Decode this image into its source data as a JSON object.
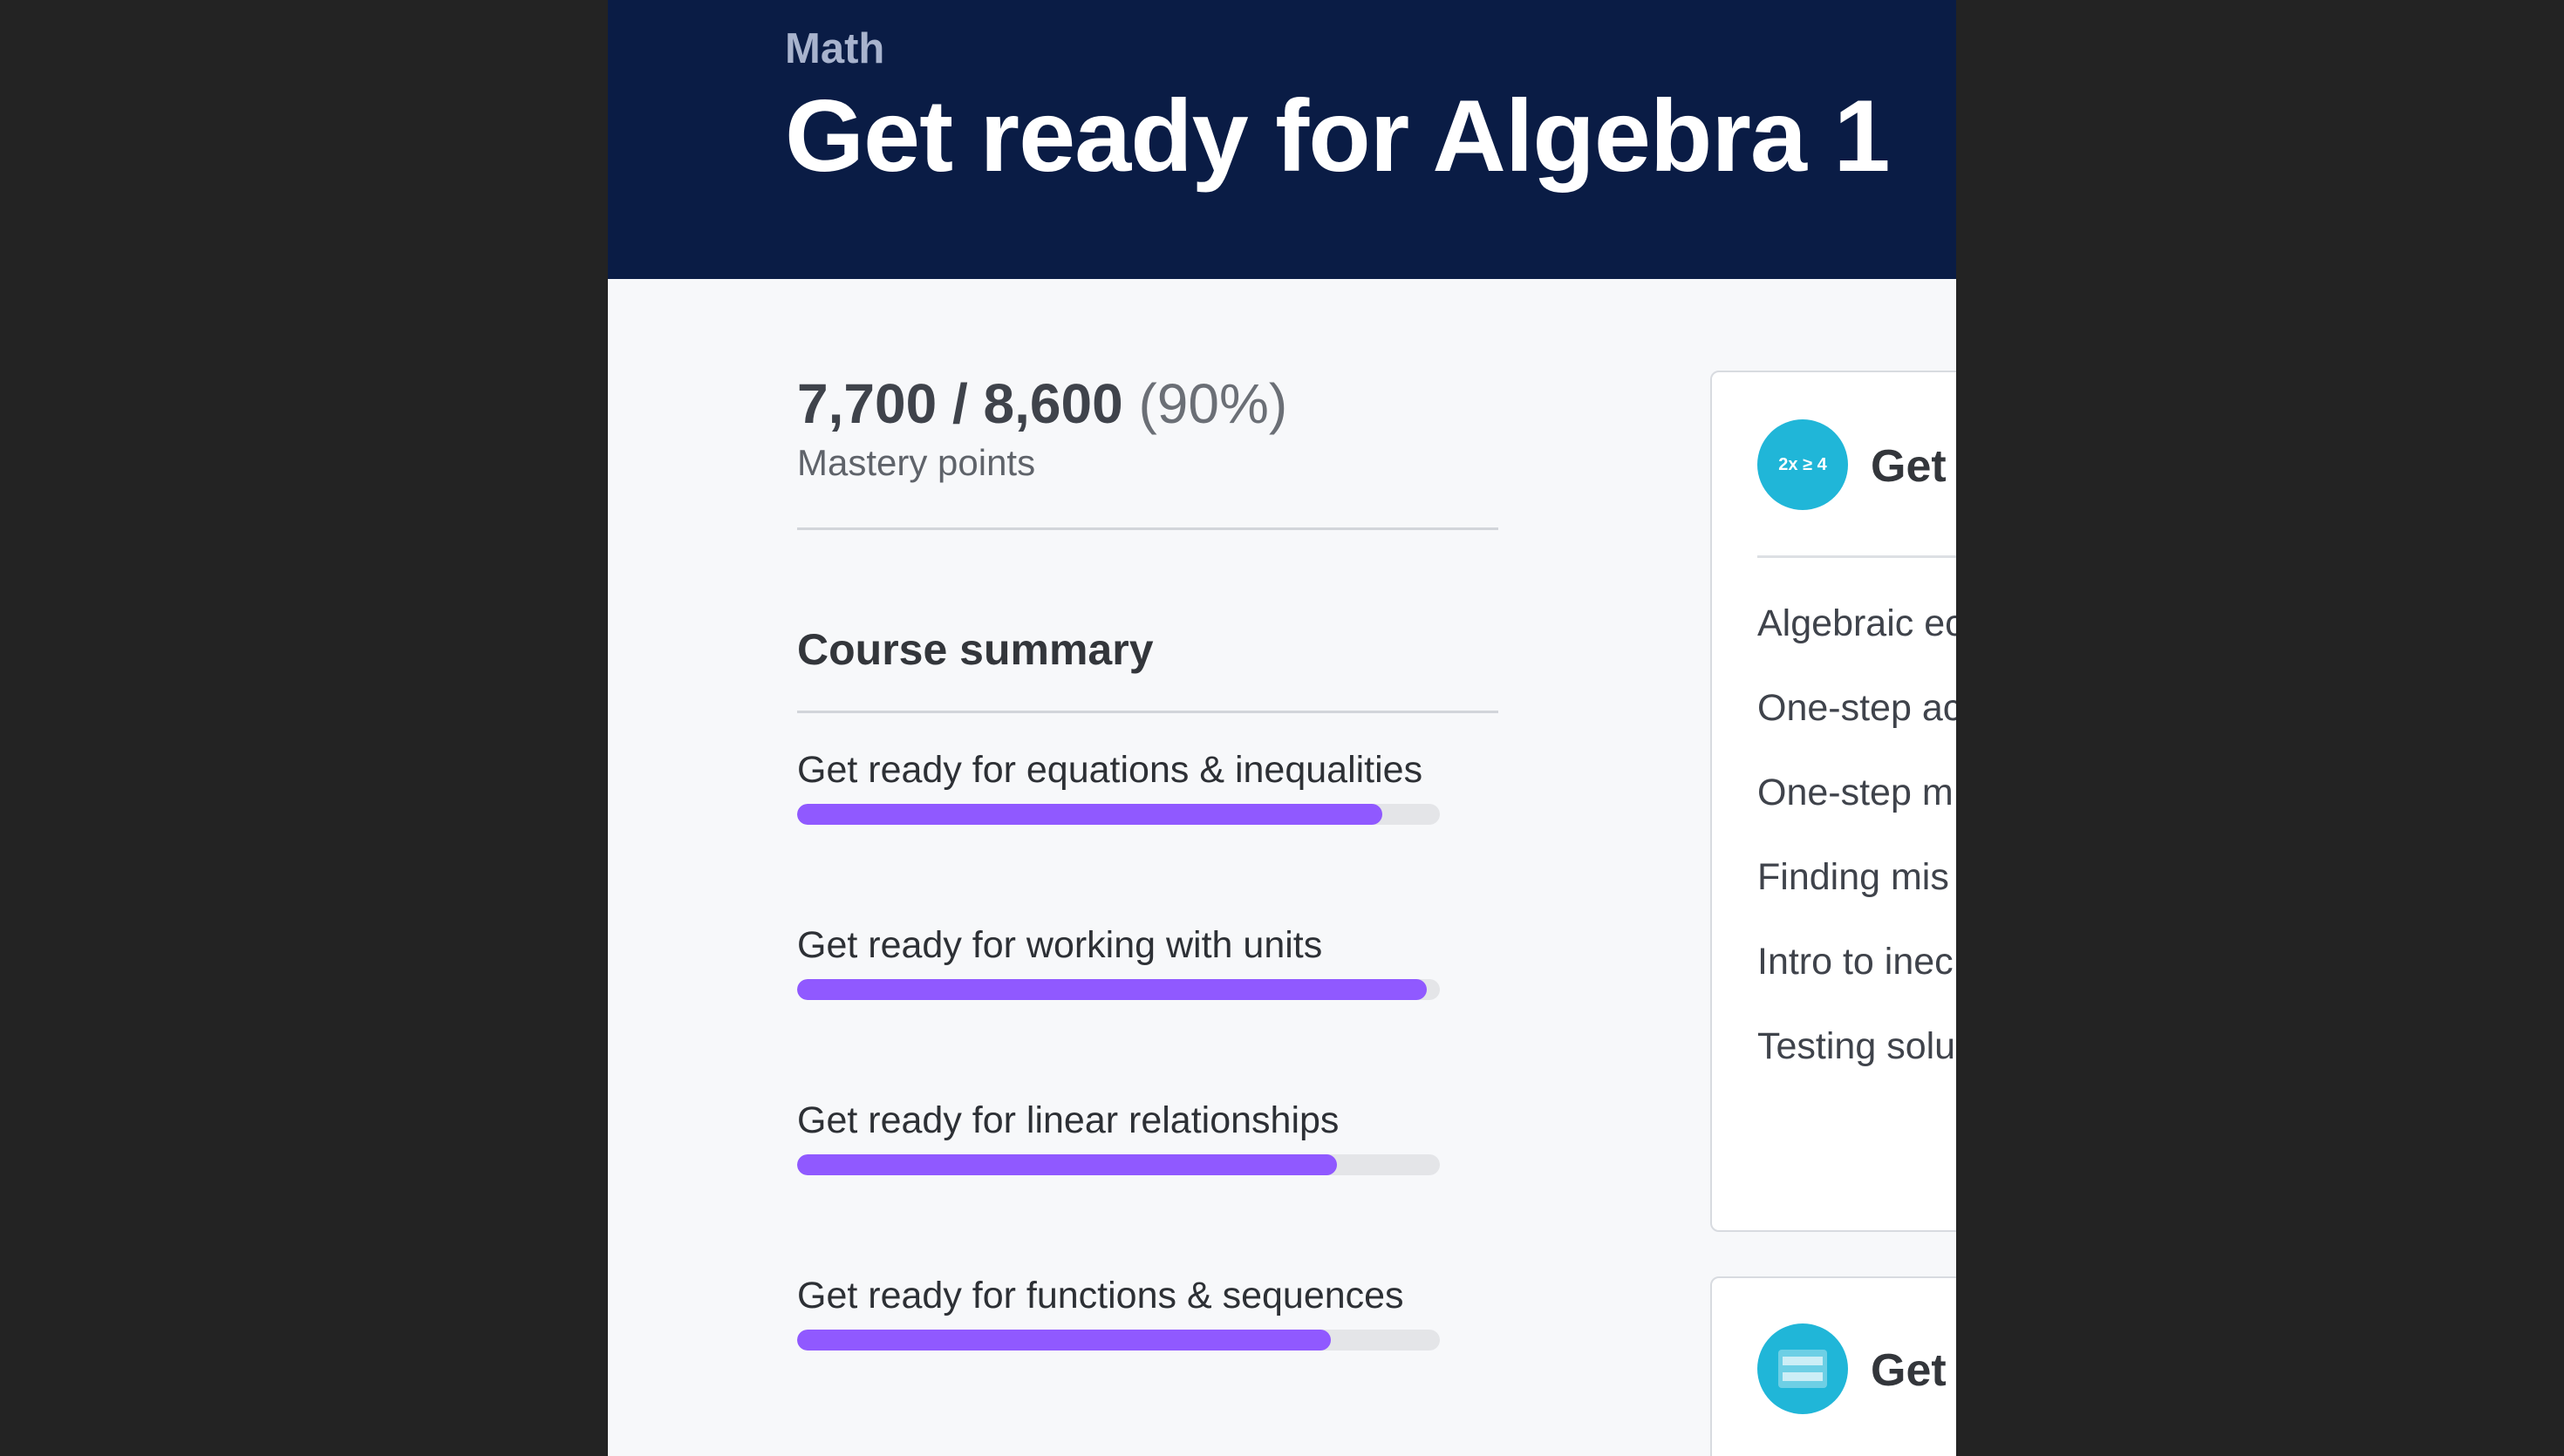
{
  "colors": {
    "background": "#232323",
    "header": "#0a1c45",
    "page": "#f7f8fa",
    "progress": "#9059ff",
    "icon": "#20b6d8"
  },
  "header": {
    "subject": "Math",
    "title": "Get ready for Algebra 1"
  },
  "mastery": {
    "current": "7,700",
    "separator": "/",
    "total": "8,600",
    "percent": "(90%)",
    "label": "Mastery points"
  },
  "course_summary": {
    "heading": "Course summary",
    "units": [
      {
        "title": "Get ready for equations & inequalities",
        "progress_percent": 91
      },
      {
        "title": "Get ready for working with units",
        "progress_percent": 98
      },
      {
        "title": "Get ready for linear relationships",
        "progress_percent": 84
      },
      {
        "title": "Get ready for functions & sequences",
        "progress_percent": 83
      }
    ]
  },
  "unit_cards": [
    {
      "icon_name": "inequality-icon",
      "icon_text": "2x ≥ 4",
      "title": "Get",
      "lessons": [
        "Algebraic ec",
        "One-step ac",
        "One-step m",
        "Finding mis",
        "Intro to inec",
        "Testing solu"
      ]
    },
    {
      "icon_name": "ruler-icon",
      "title": "Get"
    }
  ]
}
